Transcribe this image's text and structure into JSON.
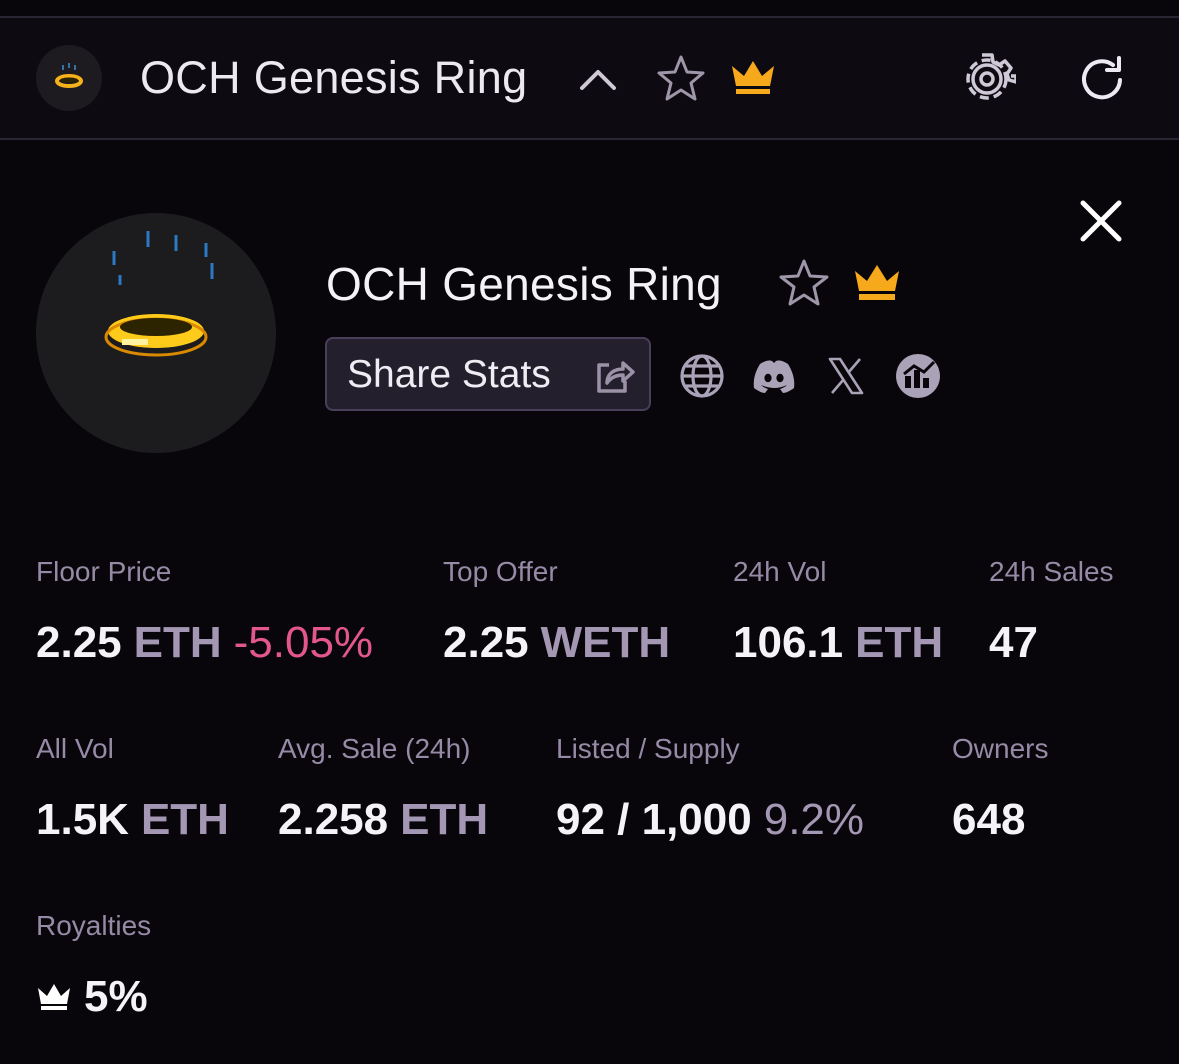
{
  "header": {
    "title": "OCH Genesis Ring",
    "icons": [
      "ring-avatar",
      "chevron-up-icon",
      "star-icon",
      "crown-icon",
      "gear-icon",
      "refresh-icon"
    ]
  },
  "collection": {
    "title": "OCH Genesis Ring",
    "share_label": "Share Stats",
    "links": [
      "globe-icon",
      "discord-icon",
      "x-icon",
      "stats-icon"
    ]
  },
  "stats": {
    "floor_price": {
      "label": "Floor Price",
      "value": "2.25",
      "unit": "ETH",
      "change": "-5.05%"
    },
    "top_offer": {
      "label": "Top Offer",
      "value": "2.25",
      "unit": "WETH"
    },
    "vol_24h": {
      "label": "24h Vol",
      "value": "106.1",
      "unit": "ETH"
    },
    "sales_24h": {
      "label": "24h Sales",
      "value": "47"
    },
    "all_vol": {
      "label": "All Vol",
      "value": "1.5K",
      "unit": "ETH"
    },
    "avg_sale": {
      "label": "Avg. Sale (24h)",
      "value": "2.258",
      "unit": "ETH"
    },
    "listed_supply": {
      "label": "Listed / Supply",
      "value": "92 / 1,000",
      "percent": "9.2%"
    },
    "owners": {
      "label": "Owners",
      "value": "648"
    },
    "royalties": {
      "label": "Royalties",
      "value": "5%"
    }
  },
  "colors": {
    "background": "#08060b",
    "accent_crown": "#f7a91c",
    "negative": "#e3578e",
    "muted": "#968aa6"
  }
}
